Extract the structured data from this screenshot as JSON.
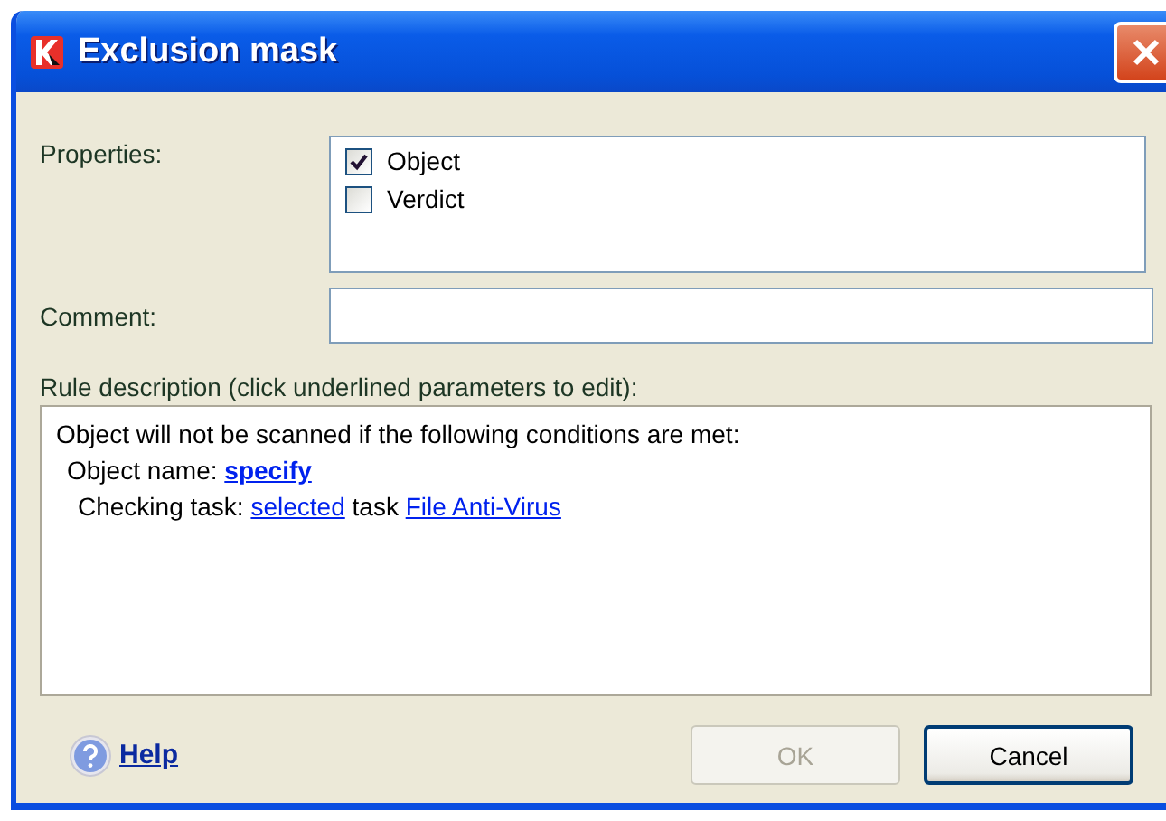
{
  "window": {
    "title": "Exclusion mask"
  },
  "properties": {
    "label": "Properties:",
    "items": [
      {
        "label": "Object",
        "checked": true
      },
      {
        "label": "Verdict",
        "checked": false
      }
    ]
  },
  "comment": {
    "label": "Comment:"
  },
  "rule_description": {
    "label": "Rule description (click underlined parameters to edit):",
    "lines": [
      [
        {
          "kind": "text",
          "text": "Object will not be scanned if the following conditions are met:"
        }
      ],
      [
        {
          "kind": "text",
          "text": "Object name: "
        },
        {
          "kind": "link",
          "text": "specify",
          "bold": true
        }
      ],
      [
        {
          "kind": "text",
          "text": "Checking task: "
        },
        {
          "kind": "link",
          "text": "selected",
          "bold": false
        },
        {
          "kind": "text",
          "text": " task "
        },
        {
          "kind": "link",
          "text": "File Anti-Virus",
          "bold": false
        }
      ]
    ]
  },
  "help": {
    "label": "Help"
  },
  "buttons": [
    {
      "label": "OK",
      "disabled": true
    },
    {
      "label": "Cancel",
      "disabled": false
    }
  ]
}
